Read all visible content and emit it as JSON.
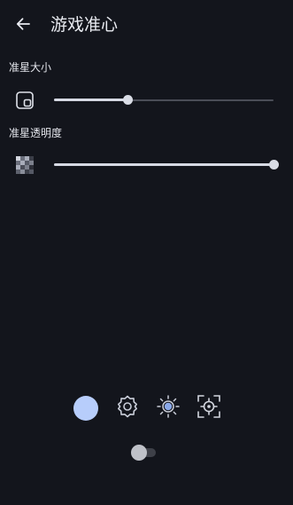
{
  "appbar": {
    "title": "游戏准心",
    "back_icon": "arrow-left-icon"
  },
  "settings": {
    "size": {
      "label": "准星大小",
      "icon": "crosshair-size-icon",
      "value": 0.335
    },
    "opacity": {
      "label": "准星透明度",
      "icon": "transparency-checker-icon",
      "value": 1.0
    }
  },
  "toolbar": {
    "items": [
      {
        "name": "color-picker",
        "icon": "color-dot",
        "color": "#b7cdfb"
      },
      {
        "name": "settings",
        "icon": "gear-icon"
      },
      {
        "name": "brightness",
        "icon": "sun-icon"
      },
      {
        "name": "crosshair-style",
        "icon": "crosshair-frame-icon"
      }
    ]
  },
  "toggle": {
    "state": "off"
  },
  "colors": {
    "background": "#13151c",
    "accent": "#b7cdfb",
    "slider_active": "#d6d9e3",
    "slider_inactive": "#4a4d57"
  }
}
